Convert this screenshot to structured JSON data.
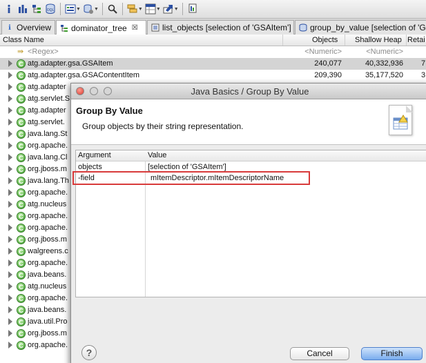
{
  "toolbar": {
    "icons": [
      "info-icon",
      "histogram-icon",
      "dominator-tree-icon",
      "oql-icon",
      "heap-dump-overview-icon",
      "query-browser-icon",
      "search-icon",
      "group-icon",
      "calculate-icon",
      "export-icon",
      "pin-icon"
    ],
    "oql_label": "OQL"
  },
  "tabs": [
    {
      "label": "Overview",
      "icon": "info-icon"
    },
    {
      "label": "dominator_tree",
      "icon": "dominator-tree-icon",
      "close": "☒"
    },
    {
      "label": "list_objects [selection of 'GSAItem']",
      "icon": "list-icon"
    },
    {
      "label": "group_by_value [selection of 'G",
      "icon": "group-icon"
    }
  ],
  "table": {
    "headers": {
      "class_name": "Class Name",
      "objects": "Objects",
      "shallow_heap": "Shallow Heap",
      "retained": "Retai"
    },
    "filter": {
      "class_name": "<Regex>",
      "objects": "<Numeric>",
      "shallow_heap": "<Numeric>"
    },
    "rows": [
      {
        "name": "atg.adapter.gsa.GSAItem",
        "objects": "240,077",
        "shallow": "40,332,936",
        "retained": "7"
      },
      {
        "name": "atg.adapter.gsa.GSAContentItem",
        "objects": "209,390",
        "shallow": "35,177,520",
        "retained": "3"
      },
      {
        "name": "atg.adapter"
      },
      {
        "name": "atg.servlet.S"
      },
      {
        "name": "atg.adapter"
      },
      {
        "name": "atg.servlet."
      },
      {
        "name": "java.lang.St"
      },
      {
        "name": "org.apache."
      },
      {
        "name": "java.lang.Cl"
      },
      {
        "name": "org.jboss.m"
      },
      {
        "name": "java.lang.Th"
      },
      {
        "name": "org.apache."
      },
      {
        "name": "atg.nucleus"
      },
      {
        "name": "org.apache."
      },
      {
        "name": "org.apache."
      },
      {
        "name": "org.jboss.m"
      },
      {
        "name": "walgreens.c"
      },
      {
        "name": "org.apache."
      },
      {
        "name": "java.beans."
      },
      {
        "name": "atg.nucleus"
      },
      {
        "name": "org.apache."
      },
      {
        "name": "java.beans."
      },
      {
        "name": "java.util.Pro"
      },
      {
        "name": "org.jboss.m"
      },
      {
        "name": "org.apache."
      }
    ]
  },
  "dialog": {
    "title": "Java Basics / Group By Value",
    "heading": "Group By Value",
    "description": "Group objects by their string representation.",
    "columns": {
      "argument": "Argument",
      "value": "Value"
    },
    "args": [
      {
        "key": "objects",
        "value": "[selection of 'GSAItem']"
      },
      {
        "key": "-field",
        "value": "mItemDescriptor.mItemDescriptorName"
      }
    ],
    "help": "?",
    "cancel": "Cancel",
    "finish": "Finish"
  },
  "colors": {
    "highlight": "#d83a3a",
    "accent_button": "#79acee",
    "class_icon": "#3d9b2c"
  }
}
